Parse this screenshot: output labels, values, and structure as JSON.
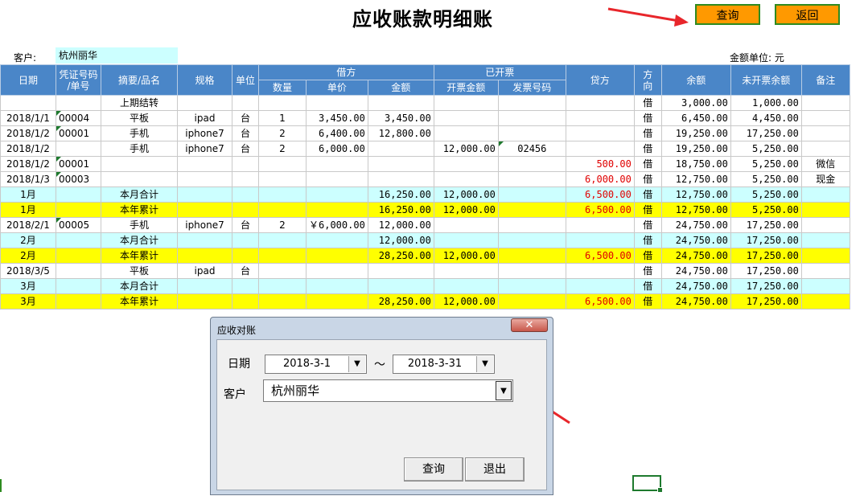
{
  "title": "应收账款明细账",
  "toolbar": {
    "query_label": "查询",
    "back_label": "返回"
  },
  "customer": {
    "label": "客户:",
    "value": "杭州丽华"
  },
  "unit_note": "金额单位: 元",
  "header": {
    "row1": [
      "日期",
      "凭证号码/单号",
      "摘要/品名",
      "规格",
      "单位",
      "借方",
      "已开票",
      "贷方",
      "方向",
      "余额",
      "未开票余额",
      "备注"
    ],
    "voucher_line1": "凭证号码",
    "voucher_line2": "/单号",
    "direction_line1": "方",
    "direction_line2": "向",
    "debit_sub": [
      "数量",
      "单价",
      "金额"
    ],
    "invoiced_sub": [
      "开票金额",
      "发票号码"
    ]
  },
  "rows": [
    {
      "date": "",
      "voucher": "",
      "summary": "上期结转",
      "spec": "",
      "unit": "",
      "qty": "",
      "price": "",
      "amount": "",
      "inv_amount": "",
      "inv_no": "",
      "credit": "",
      "dir": "借",
      "balance": "3,000.00",
      "uninv": "1,000.00",
      "note": ""
    },
    {
      "date": "2018/1/1",
      "voucher": "00004",
      "summary": "平板",
      "spec": "ipad",
      "unit": "台",
      "qty": "1",
      "price": "3,450.00",
      "amount": "3,450.00",
      "inv_amount": "",
      "inv_no": "",
      "credit": "",
      "dir": "借",
      "balance": "6,450.00",
      "uninv": "4,450.00",
      "note": ""
    },
    {
      "date": "2018/1/2",
      "voucher": "00001",
      "summary": "手机",
      "spec": "iphone7",
      "unit": "台",
      "qty": "2",
      "price": "6,400.00",
      "amount": "12,800.00",
      "inv_amount": "",
      "inv_no": "",
      "credit": "",
      "dir": "借",
      "balance": "19,250.00",
      "uninv": "17,250.00",
      "note": ""
    },
    {
      "date": "2018/1/2",
      "voucher": "",
      "summary": "手机",
      "spec": "iphone7",
      "unit": "台",
      "qty": "2",
      "price": "6,000.00",
      "amount": "",
      "inv_amount": "12,000.00",
      "inv_no": "02456",
      "credit": "",
      "dir": "借",
      "balance": "19,250.00",
      "uninv": "5,250.00",
      "note": ""
    },
    {
      "date": "2018/1/2",
      "voucher": "00001",
      "summary": "",
      "spec": "",
      "unit": "",
      "qty": "",
      "price": "",
      "amount": "",
      "inv_amount": "",
      "inv_no": "",
      "credit": "500.00",
      "dir": "借",
      "balance": "18,750.00",
      "uninv": "5,250.00",
      "note": "微信"
    },
    {
      "date": "2018/1/3",
      "voucher": "00003",
      "summary": "",
      "spec": "",
      "unit": "",
      "qty": "",
      "price": "",
      "amount": "",
      "inv_amount": "",
      "inv_no": "",
      "credit": "6,000.00",
      "dir": "借",
      "balance": "12,750.00",
      "uninv": "5,250.00",
      "note": "现金"
    },
    {
      "date": "1月",
      "voucher": "",
      "summary": "本月合计",
      "spec": "",
      "unit": "",
      "qty": "",
      "price": "",
      "amount": "16,250.00",
      "inv_amount": "12,000.00",
      "inv_no": "",
      "credit": "6,500.00",
      "dir": "借",
      "balance": "12,750.00",
      "uninv": "5,250.00",
      "note": "",
      "style": "cyan"
    },
    {
      "date": "1月",
      "voucher": "",
      "summary": "本年累计",
      "spec": "",
      "unit": "",
      "qty": "",
      "price": "",
      "amount": "16,250.00",
      "inv_amount": "12,000.00",
      "inv_no": "",
      "credit": "6,500.00",
      "dir": "借",
      "balance": "12,750.00",
      "uninv": "5,250.00",
      "note": "",
      "style": "yellow"
    },
    {
      "date": "2018/2/1",
      "voucher": "00005",
      "summary": "手机",
      "spec": "iphone7",
      "unit": "台",
      "qty": "2",
      "price": "￥6,000.00",
      "amount": "12,000.00",
      "inv_amount": "",
      "inv_no": "",
      "credit": "",
      "dir": "借",
      "balance": "24,750.00",
      "uninv": "17,250.00",
      "note": ""
    },
    {
      "date": "2月",
      "voucher": "",
      "summary": "本月合计",
      "spec": "",
      "unit": "",
      "qty": "",
      "price": "",
      "amount": "12,000.00",
      "inv_amount": "",
      "inv_no": "",
      "credit": "",
      "dir": "借",
      "balance": "24,750.00",
      "uninv": "17,250.00",
      "note": "",
      "style": "cyan"
    },
    {
      "date": "2月",
      "voucher": "",
      "summary": "本年累计",
      "spec": "",
      "unit": "",
      "qty": "",
      "price": "",
      "amount": "28,250.00",
      "inv_amount": "12,000.00",
      "inv_no": "",
      "credit": "6,500.00",
      "dir": "借",
      "balance": "24,750.00",
      "uninv": "17,250.00",
      "note": "",
      "style": "yellow"
    },
    {
      "date": "2018/3/5",
      "voucher": "",
      "summary": "平板",
      "spec": "ipad",
      "unit": "台",
      "qty": "",
      "price": "",
      "amount": "",
      "inv_amount": "",
      "inv_no": "",
      "credit": "",
      "dir": "借",
      "balance": "24,750.00",
      "uninv": "17,250.00",
      "note": ""
    },
    {
      "date": "3月",
      "voucher": "",
      "summary": "本月合计",
      "spec": "",
      "unit": "",
      "qty": "",
      "price": "",
      "amount": "",
      "inv_amount": "",
      "inv_no": "",
      "credit": "",
      "dir": "借",
      "balance": "24,750.00",
      "uninv": "17,250.00",
      "note": "",
      "style": "cyan"
    },
    {
      "date": "3月",
      "voucher": "",
      "summary": "本年累计",
      "spec": "",
      "unit": "",
      "qty": "",
      "price": "",
      "amount": "28,250.00",
      "inv_amount": "12,000.00",
      "inv_no": "",
      "credit": "6,500.00",
      "dir": "借",
      "balance": "24,750.00",
      "uninv": "17,250.00",
      "note": "",
      "style": "yellow"
    }
  ],
  "dialog": {
    "title": "应收对账",
    "close_label": "✕",
    "date_label": "日期",
    "date_from": "2018-3-1",
    "tilde": "～",
    "date_to": "2018-3-31",
    "customer_label": "客户",
    "customer_value": "杭州丽华",
    "dropdown_glyph": "▼",
    "query_label": "查询",
    "exit_label": "退出"
  },
  "colors": {
    "header_blue": "#4a86c8",
    "orange_button": "#ff9900",
    "month_total": "#ccffff",
    "year_total": "#ffff00",
    "credit_red": "#e00000",
    "arrow_red": "#e8262b"
  }
}
